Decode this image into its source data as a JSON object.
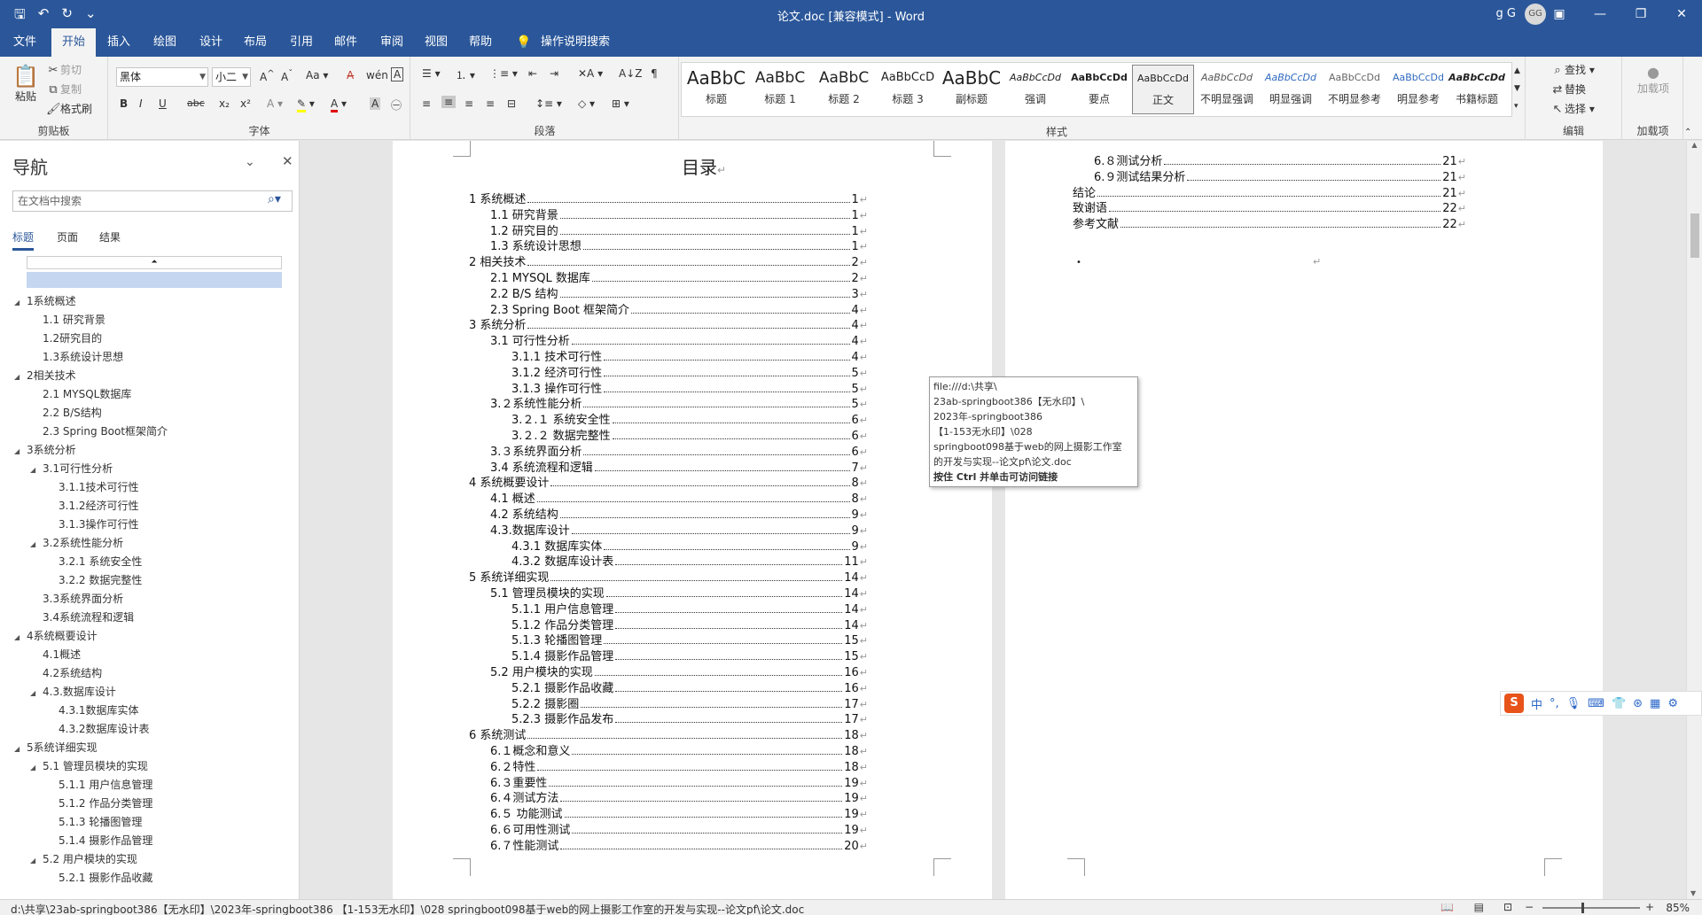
{
  "titlebar": {
    "title": "论文.doc [兼容模式] - Word",
    "user": "g G",
    "avatar_initials": "GG",
    "qa_icons": [
      "save-icon",
      "undo-icon",
      "redo-icon",
      "customize-icon"
    ],
    "win_buttons": [
      "ribbon-options-icon",
      "minimize-icon",
      "restore-icon",
      "close-icon"
    ]
  },
  "tabs": [
    "文件",
    "开始",
    "插入",
    "绘图",
    "设计",
    "布局",
    "引用",
    "邮件",
    "审阅",
    "视图",
    "帮助",
    "操作说明搜索"
  ],
  "active_tab": "开始",
  "ribbon": {
    "clipboard": {
      "paste": "粘贴",
      "cut": "剪切",
      "copy": "复制",
      "format_painter": "格式刷",
      "label": "剪贴板"
    },
    "font": {
      "name": "黑体",
      "size": "小二",
      "label": "字体",
      "buttons": [
        "B",
        "I",
        "U",
        "abc",
        "x₂",
        "x²"
      ],
      "case": "Aa"
    },
    "paragraph": {
      "label": "段落"
    },
    "styles": {
      "label": "样式",
      "items": [
        {
          "sample": "AaBbC",
          "name": "标题"
        },
        {
          "sample": "AaBbC",
          "name": "标题 1"
        },
        {
          "sample": "AaBbC",
          "name": "标题 2"
        },
        {
          "sample": "AaBbCcD",
          "name": "标题 3"
        },
        {
          "sample": "AaBbC",
          "name": "副标题"
        },
        {
          "sample": "AaBbCcDd",
          "name": "强调"
        },
        {
          "sample": "AaBbCcDd",
          "name": "要点"
        },
        {
          "sample": "AaBbCcDd",
          "name": "正文"
        },
        {
          "sample": "AaBbCcDd",
          "name": "不明显强调"
        },
        {
          "sample": "AaBbCcDd",
          "name": "明显强调"
        },
        {
          "sample": "AaBbCcDd",
          "name": "不明显参考"
        },
        {
          "sample": "AaBbCcDd",
          "name": "明显参考"
        },
        {
          "sample": "AaBbCcDd",
          "name": "书籍标题"
        }
      ],
      "selected_index": 7
    },
    "editing": {
      "find": "查找",
      "replace": "替换",
      "select": "选择",
      "label": "编辑"
    },
    "addins": {
      "button": "加载项",
      "label": "加载项"
    }
  },
  "nav": {
    "title": "导航",
    "search_placeholder": "在文档中搜索",
    "tabs": [
      "标题",
      "页面",
      "结果"
    ],
    "items": [
      {
        "text": "1系统概述",
        "level": 1,
        "toggle": true
      },
      {
        "text": "1.1 研究背景",
        "level": 2,
        "toggle": false
      },
      {
        "text": "1.2研究目的",
        "level": 2,
        "toggle": false
      },
      {
        "text": "1.3系统设计思想",
        "level": 2,
        "toggle": false
      },
      {
        "text": "2相关技术",
        "level": 1,
        "toggle": true
      },
      {
        "text": "2.1 MYSQL数据库",
        "level": 2,
        "toggle": false
      },
      {
        "text": "2.2 B/S结构",
        "level": 2,
        "toggle": false
      },
      {
        "text": "2.3 Spring Boot框架简介",
        "level": 2,
        "toggle": false
      },
      {
        "text": "3系统分析",
        "level": 1,
        "toggle": true
      },
      {
        "text": "3.1可行性分析",
        "level": 2,
        "toggle": true
      },
      {
        "text": "3.1.1技术可行性",
        "level": 3,
        "toggle": false
      },
      {
        "text": "3.1.2经济可行性",
        "level": 3,
        "toggle": false
      },
      {
        "text": "3.1.3操作可行性",
        "level": 3,
        "toggle": false
      },
      {
        "text": "3.2系统性能分析",
        "level": 2,
        "toggle": true
      },
      {
        "text": "3.2.1 系统安全性",
        "level": 3,
        "toggle": false
      },
      {
        "text": "3.2.2 数据完整性",
        "level": 3,
        "toggle": false
      },
      {
        "text": "3.3系统界面分析",
        "level": 2,
        "toggle": false
      },
      {
        "text": "3.4系统流程和逻辑",
        "level": 2,
        "toggle": false
      },
      {
        "text": "4系统概要设计",
        "level": 1,
        "toggle": true
      },
      {
        "text": "4.1概述",
        "level": 2,
        "toggle": false
      },
      {
        "text": "4.2系统结构",
        "level": 2,
        "toggle": false
      },
      {
        "text": "4.3.数据库设计",
        "level": 2,
        "toggle": true
      },
      {
        "text": "4.3.1数据库实体",
        "level": 3,
        "toggle": false
      },
      {
        "text": "4.3.2数据库设计表",
        "level": 3,
        "toggle": false
      },
      {
        "text": "5系统详细实现",
        "level": 1,
        "toggle": true
      },
      {
        "text": "5.1 管理员模块的实现",
        "level": 2,
        "toggle": true
      },
      {
        "text": "5.1.1 用户信息管理",
        "level": 3,
        "toggle": false
      },
      {
        "text": "5.1.2 作品分类管理",
        "level": 3,
        "toggle": false
      },
      {
        "text": "5.1.3 轮播图管理",
        "level": 3,
        "toggle": false
      },
      {
        "text": "5.1.4 摄影作品管理",
        "level": 3,
        "toggle": false
      },
      {
        "text": "5.2 用户模块的实现",
        "level": 2,
        "toggle": true
      },
      {
        "text": "5.2.1 摄影作品收藏",
        "level": 3,
        "toggle": false
      }
    ]
  },
  "toc": {
    "title": "目录",
    "page1": [
      {
        "text": "1 系统概述",
        "page": "1",
        "level": 1
      },
      {
        "text": "1.1  研究背景",
        "page": "1",
        "level": 2
      },
      {
        "text": "1.2 研究目的",
        "page": "1",
        "level": 2
      },
      {
        "text": "1.3 系统设计思想",
        "page": "1",
        "level": 2
      },
      {
        "text": "2 相关技术",
        "page": "2",
        "level": 1
      },
      {
        "text": "2.1 MYSQL 数据库",
        "page": "2",
        "level": 2
      },
      {
        "text": "2.2 B/S 结构",
        "page": "3",
        "level": 2
      },
      {
        "text": "2.3 Spring Boot 框架简介",
        "page": "4",
        "level": 2
      },
      {
        "text": "3 系统分析",
        "page": "4",
        "level": 1
      },
      {
        "text": "3.1 可行性分析",
        "page": "4",
        "level": 2
      },
      {
        "text": "3.1.1 技术可行性",
        "page": "4",
        "level": 3
      },
      {
        "text": "3.1.2 经济可行性",
        "page": "5",
        "level": 3
      },
      {
        "text": "3.1.3 操作可行性",
        "page": "5",
        "level": 3
      },
      {
        "text": "3.２系统性能分析",
        "page": "5",
        "level": 2
      },
      {
        "text": "3.２.１ 系统安全性",
        "page": "6",
        "level": 3
      },
      {
        "text": "3.２.２ 数据完整性",
        "page": "6",
        "level": 3
      },
      {
        "text": "3.３系统界面分析",
        "page": "6",
        "level": 2
      },
      {
        "text": "3.4 系统流程和逻辑",
        "page": "7",
        "level": 2
      },
      {
        "text": "4 系统概要设计",
        "page": "8",
        "level": 1
      },
      {
        "text": "4.1 概述",
        "page": "8",
        "level": 2
      },
      {
        "text": "4.2 系统结构",
        "page": "9",
        "level": 2
      },
      {
        "text": "4.3.数据库设计",
        "page": "9",
        "level": 2
      },
      {
        "text": "4.3.1 数据库实体",
        "page": "9",
        "level": 3
      },
      {
        "text": "4.3.2 数据库设计表",
        "page": "11",
        "level": 3
      },
      {
        "text": "5 系统详细实现",
        "page": "14",
        "level": 1
      },
      {
        "text": "5.1  管理员模块的实现",
        "page": "14",
        "level": 2
      },
      {
        "text": "5.1.1  用户信息管理",
        "page": "14",
        "level": 3
      },
      {
        "text": "5.1.2  作品分类管理",
        "page": "14",
        "level": 3
      },
      {
        "text": "5.1.3  轮播图管理",
        "page": "15",
        "level": 3
      },
      {
        "text": "5.1.4  摄影作品管理",
        "page": "15",
        "level": 3
      },
      {
        "text": "5.2  用户模块的实现",
        "page": "16",
        "level": 2
      },
      {
        "text": "5.2.1  摄影作品收藏",
        "page": "16",
        "level": 3
      },
      {
        "text": "5.2.2  摄影圈",
        "page": "17",
        "level": 3
      },
      {
        "text": "5.2.3  摄影作品发布",
        "page": "17",
        "level": 3
      },
      {
        "text": "6 系统测试",
        "page": "18",
        "level": 1
      },
      {
        "text": "6.１概念和意义",
        "page": "18",
        "level": 2
      },
      {
        "text": "6.２特性",
        "page": "18",
        "level": 2
      },
      {
        "text": "6.３重要性",
        "page": "19",
        "level": 2
      },
      {
        "text": "6.４测试方法",
        "page": "19",
        "level": 2
      },
      {
        "text": "6.５ 功能测试",
        "page": "19",
        "level": 2
      },
      {
        "text": "6.６可用性测试",
        "page": "19",
        "level": 2
      },
      {
        "text": "6.７性能测试",
        "page": "20",
        "level": 2
      }
    ],
    "page2": [
      {
        "text": "6.８测试分析",
        "page": "21",
        "level": 2
      },
      {
        "text": "6.９测试结果分析",
        "page": "21",
        "level": 2
      },
      {
        "text": "结论",
        "page": "21",
        "level": 1
      },
      {
        "text": "致谢语",
        "page": "22",
        "level": 1
      },
      {
        "text": "参考文献",
        "page": "22",
        "level": 1
      }
    ]
  },
  "tooltip": {
    "lines": [
      "file:///d:\\共享\\",
      "23ab-springboot386【无水印】\\",
      "2023年-springboot386",
      "【1-153无水印】\\028",
      "springboot098基于web的网上摄影工作室",
      "的开发与实现--论文pf\\论文.doc"
    ],
    "hint": "按住 Ctrl 并单击可访问链接"
  },
  "ime": {
    "logo": "S",
    "mode": "中"
  },
  "statusbar": {
    "path": "d:\\共享\\23ab-springboot386【无水印】\\2023年-springboot386 【1-153无水印】\\028 springboot098基于web的网上摄影工作室的开发与实现--论文pf\\论文.doc",
    "zoom": "85%"
  }
}
